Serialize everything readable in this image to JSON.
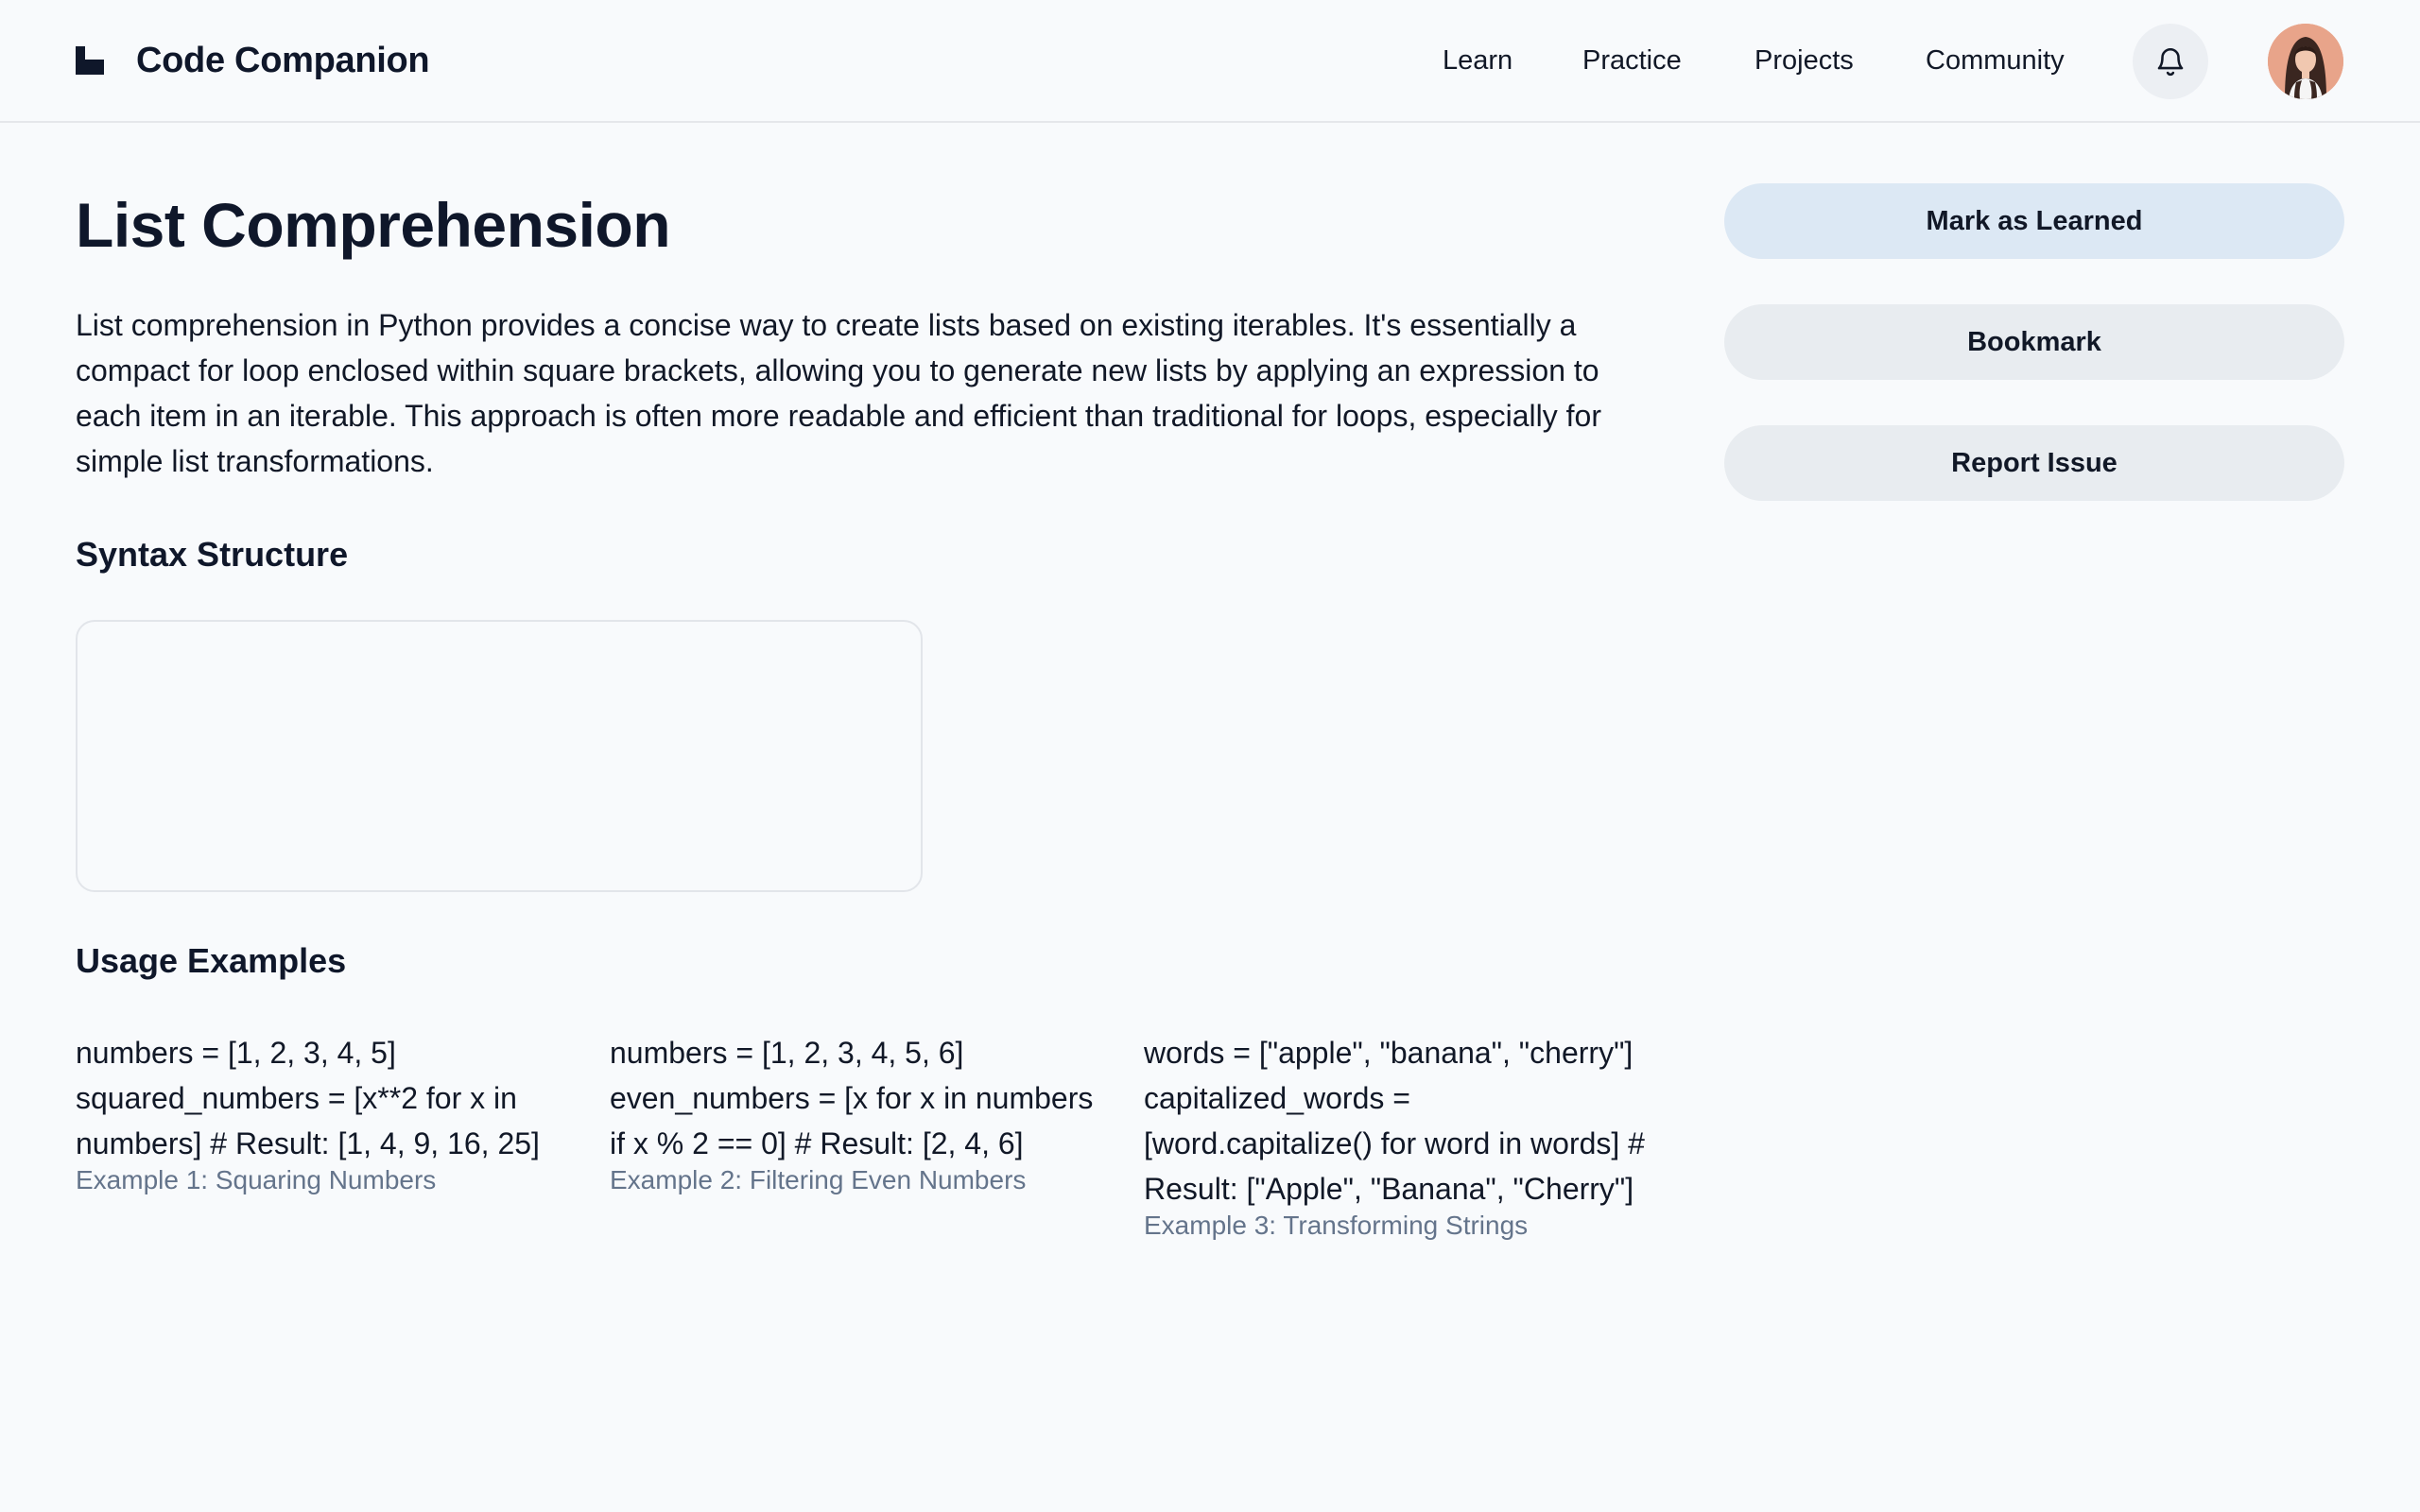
{
  "app": {
    "name": "Code Companion"
  },
  "nav": {
    "items": [
      {
        "label": "Learn"
      },
      {
        "label": "Practice"
      },
      {
        "label": "Projects"
      },
      {
        "label": "Community"
      }
    ],
    "icons": {
      "notifications": "bell-icon",
      "profile": "avatar"
    }
  },
  "lesson": {
    "title": "List Comprehension",
    "description": "List comprehension in Python provides a concise way to create lists based on existing iterables. It's essentially a compact for loop enclosed within square brackets, allowing you to generate new lists by applying an expression to each item in an iterable. This approach is often more readable and efficient than traditional for loops, especially for simple list transformations.",
    "syntax_heading": "Syntax Structure",
    "examples_heading": "Usage Examples",
    "examples": [
      {
        "code": "numbers = [1, 2, 3, 4, 5] squared_numbers = [x**2 for x in numbers] # Result: [1, 4, 9, 16, 25]",
        "caption": "Example 1: Squaring Numbers"
      },
      {
        "code": "numbers = [1, 2, 3, 4, 5, 6] even_numbers = [x for x in numbers if x % 2 == 0] # Result: [2, 4, 6]",
        "caption": "Example 2: Filtering Even Numbers"
      },
      {
        "code": "words = [\"apple\", \"banana\", \"cherry\"] capitalized_words = [word.capitalize() for word in words] # Result: [\"Apple\", \"Banana\", \"Cherry\"]",
        "caption": "Example 3: Transforming Strings"
      }
    ]
  },
  "actions": {
    "mark_learned": "Mark as Learned",
    "bookmark": "Bookmark",
    "report_issue": "Report Issue"
  },
  "colors": {
    "background": "#f8fafc",
    "primary_button": "#dce8f4",
    "secondary_button": "#e8ecf0",
    "caption": "#64748b",
    "text": "#0f172a"
  }
}
